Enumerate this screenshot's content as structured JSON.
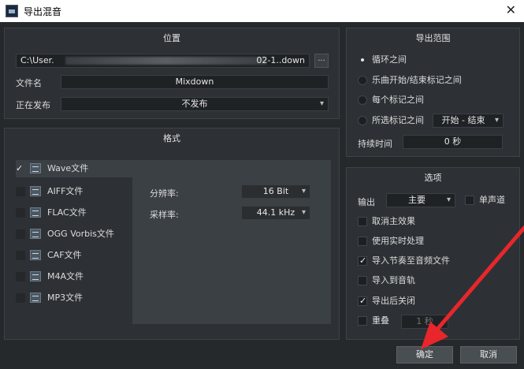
{
  "window": {
    "title": "导出混音",
    "close_glyph": "✕"
  },
  "location_panel": {
    "header": "位置",
    "path_prefix": "C:\\User.",
    "path_suffix": "02-1..down",
    "browse_label": "...",
    "filename_label": "文件名",
    "filename_value": "Mixdown",
    "publishing_label": "正在发布",
    "publishing_value": "不发布"
  },
  "format_panel": {
    "header": "格式",
    "formats": [
      {
        "label": "Wave文件",
        "checked": true,
        "selected": true
      },
      {
        "label": "AIFF文件",
        "checked": false
      },
      {
        "label": "FLAC文件",
        "checked": false
      },
      {
        "label": "OGG Vorbis文件",
        "checked": false
      },
      {
        "label": "CAF文件",
        "checked": false
      },
      {
        "label": "M4A文件",
        "checked": false
      },
      {
        "label": "MP3文件",
        "checked": false
      }
    ],
    "resolution_label": "分辨率:",
    "resolution_value": "16 Bit",
    "samplerate_label": "采样率:",
    "samplerate_value": "44.1 kHz"
  },
  "range_panel": {
    "header": "导出范围",
    "options": [
      {
        "label": "循环之间",
        "selected": true
      },
      {
        "label": "乐曲开始/结束标记之间",
        "selected": false
      },
      {
        "label": "每个标记之间",
        "selected": false
      },
      {
        "label": "所选标记之间",
        "selected": false
      }
    ],
    "marker_select_value": "开始 - 结束",
    "duration_label": "持续时间",
    "duration_value": "0 秒"
  },
  "options_panel": {
    "header": "选项",
    "output_label": "输出",
    "output_value": "主要",
    "mono_label": "单声道",
    "checks": [
      {
        "label": "取消主效果",
        "checked": false
      },
      {
        "label": "使用实时处理",
        "checked": false
      },
      {
        "label": "导入节奏至音频文件",
        "checked": true
      },
      {
        "label": "导入到音轨",
        "checked": false
      },
      {
        "label": "导出后关闭",
        "checked": true
      }
    ],
    "overlap_label": "重叠",
    "overlap_value": "1 秒"
  },
  "buttons": {
    "ok": "确定",
    "cancel": "取消"
  },
  "colors": {
    "annotation_arrow": "#e8262b"
  }
}
